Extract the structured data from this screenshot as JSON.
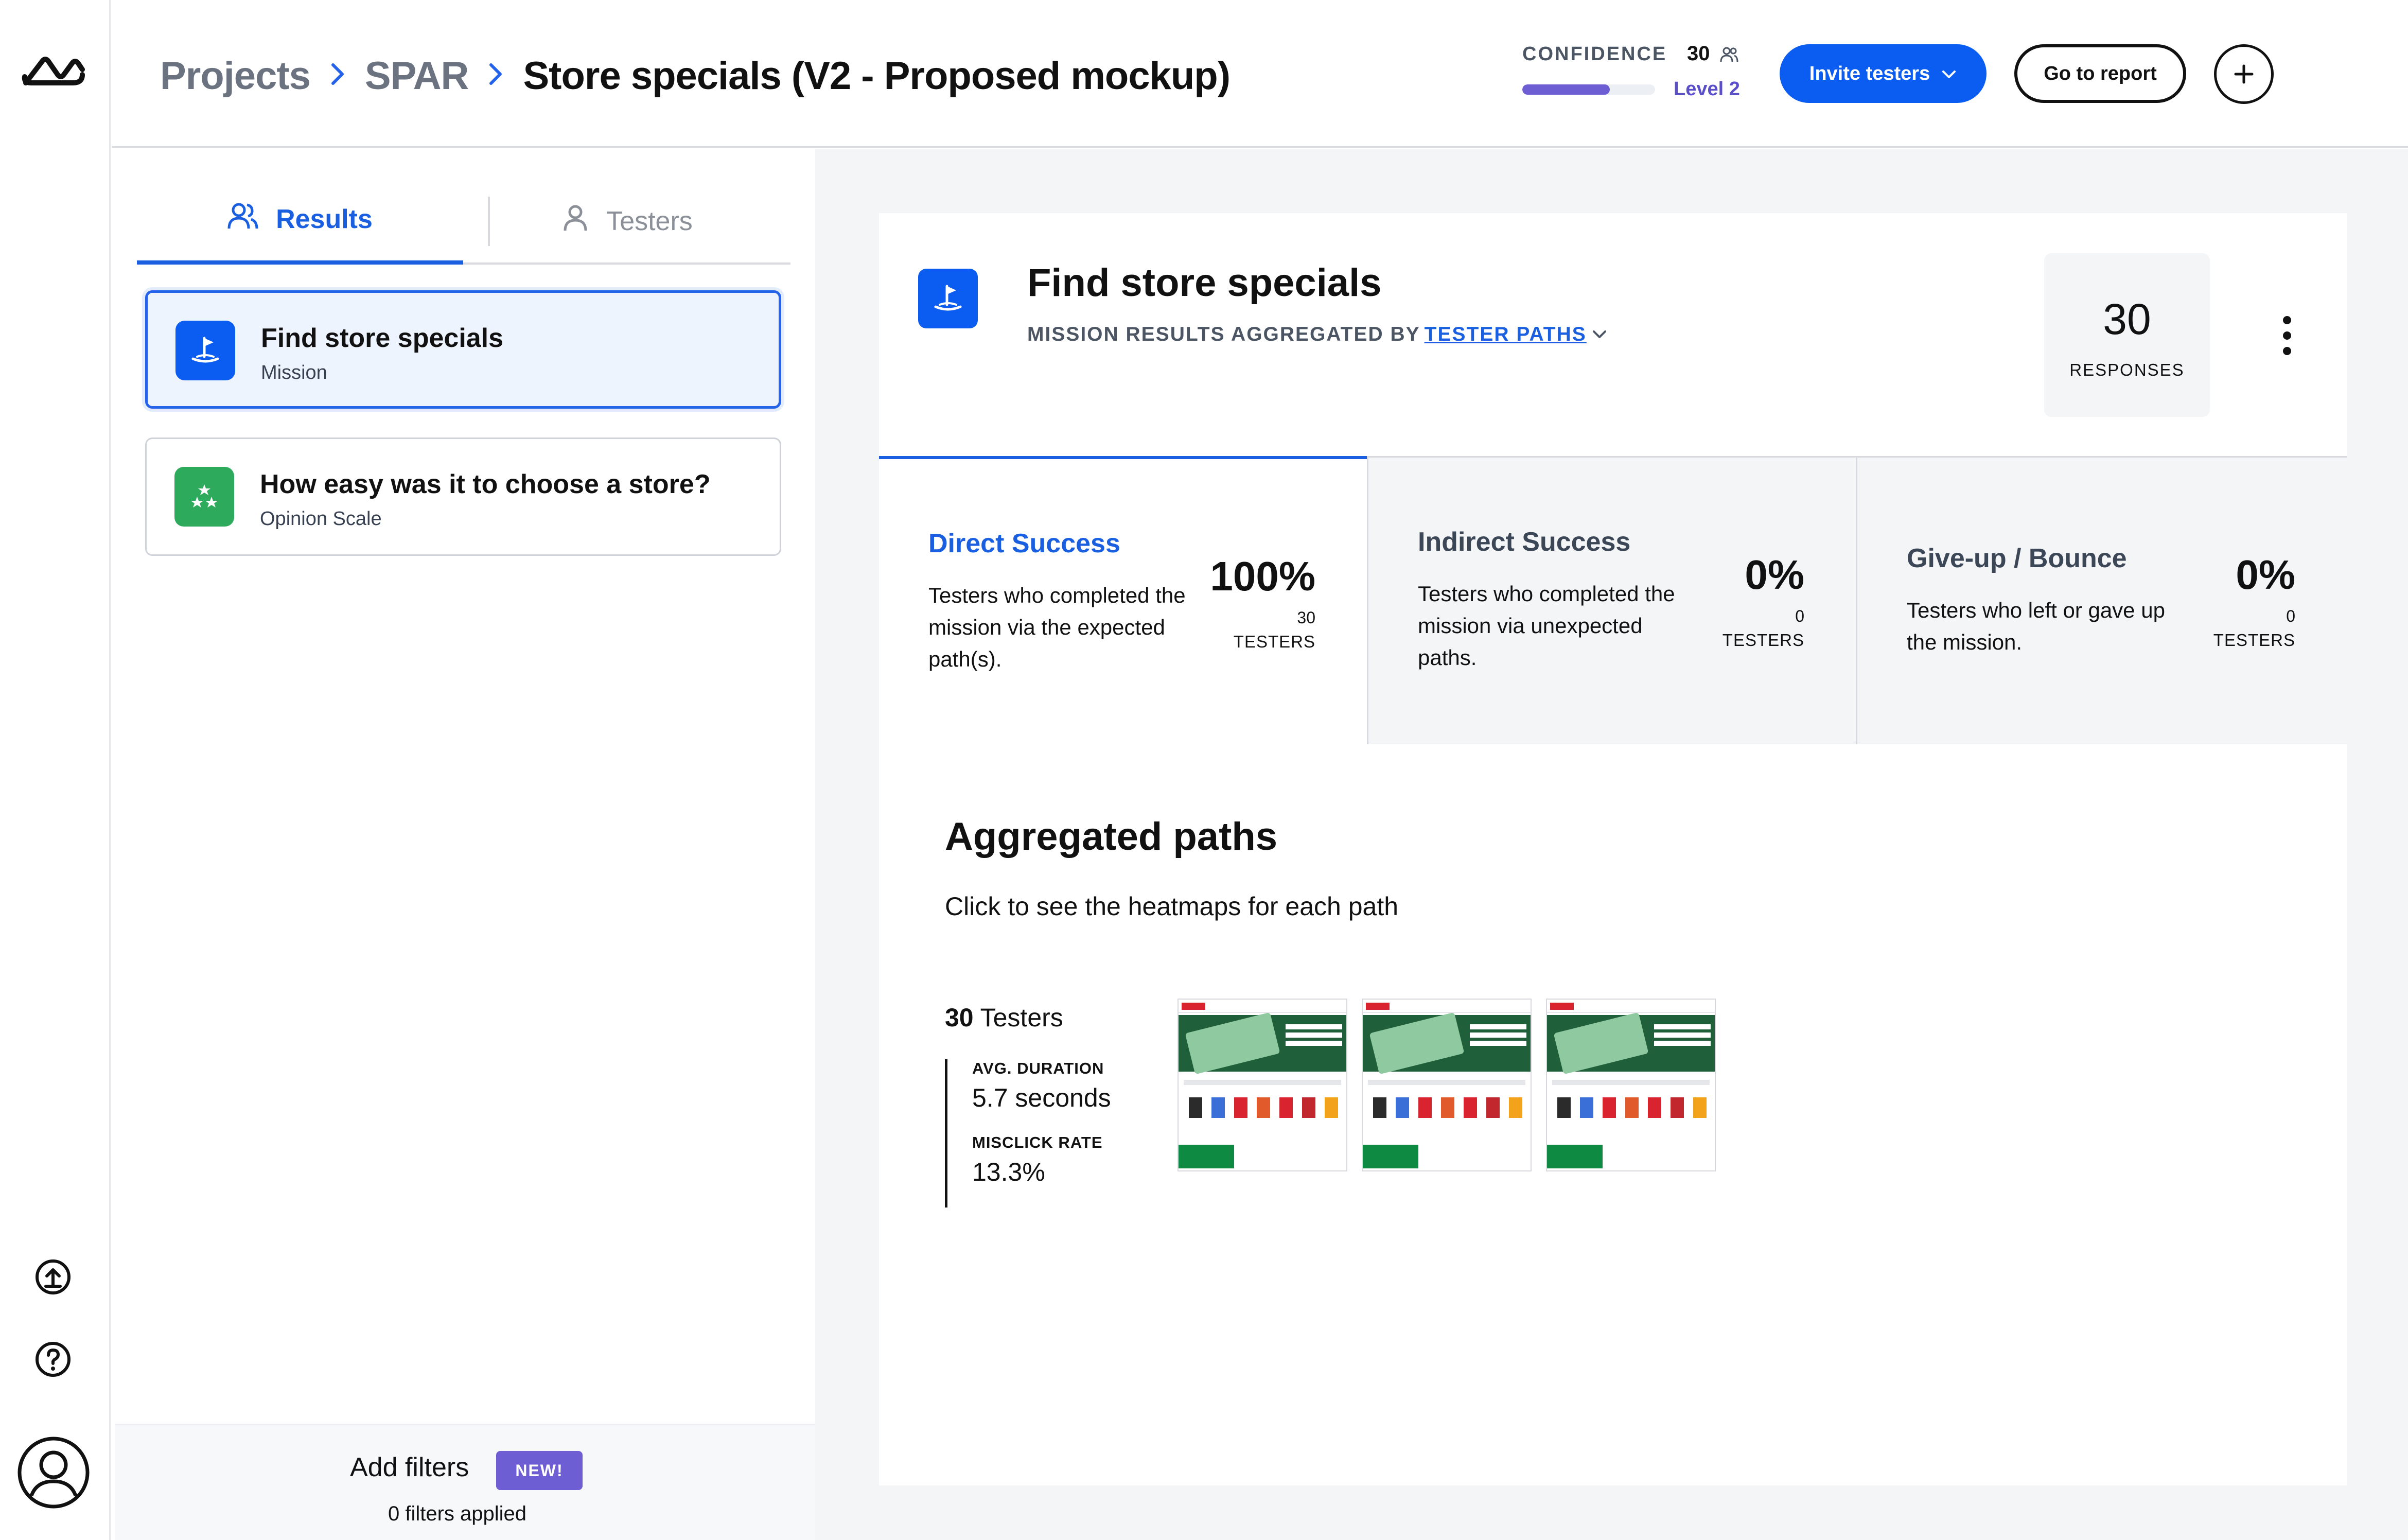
{
  "header": {
    "breadcrumbs": [
      "Projects",
      "SPAR",
      "Store specials (V2 - Proposed mockup)"
    ],
    "confidence": {
      "label": "CONFIDENCE",
      "tester_count": "30",
      "level": "Level 2",
      "progress_fraction": 0.66
    },
    "invite_button": "Invite testers",
    "report_button": "Go to report",
    "add_icon": "plus-icon",
    "settings_icon": "gear-icon"
  },
  "sidebar": {
    "tabs": [
      {
        "label": "Results",
        "icon": "people-icon",
        "active": true
      },
      {
        "label": "Testers",
        "icon": "person-icon",
        "active": false
      }
    ],
    "blocks": [
      {
        "title": "Find store specials",
        "subtitle": "Mission",
        "icon": "mission-flag-icon",
        "color": "#0b5cf0",
        "selected": true
      },
      {
        "title": "How easy was it to choose a store?",
        "subtitle": "Opinion Scale",
        "icon": "stars-icon",
        "color": "#2eaa5c",
        "selected": false
      }
    ],
    "filters": {
      "label": "Add filters",
      "badge": "NEW!",
      "applied": "0 filters applied"
    }
  },
  "rail": {
    "icons": [
      "maze-logo-icon",
      "upload-icon",
      "help-icon",
      "avatar-icon"
    ]
  },
  "main": {
    "title": "Find store specials",
    "subtitle_prefix": "MISSION RESULTS AGGREGATED BY",
    "subtitle_link": "TESTER PATHS",
    "responses": {
      "value": "30",
      "label": "RESPONSES"
    },
    "stats": [
      {
        "title": "Direct Success",
        "description": "Testers who completed the mission via the expected path(s).",
        "percent": "100%",
        "count": "30",
        "unit": "TESTERS",
        "title_color": "#1a5fe0"
      },
      {
        "title": "Indirect Success",
        "description": "Testers who completed the mission via unexpected paths.",
        "percent": "0%",
        "count": "0",
        "unit": "TESTERS",
        "title_color": "#3b4656"
      },
      {
        "title": "Give-up / Bounce",
        "description": "Testers who left or gave up the mission.",
        "percent": "0%",
        "count": "0",
        "unit": "TESTERS",
        "title_color": "#3b4656"
      }
    ],
    "aggregated": {
      "title": "Aggregated paths",
      "subtitle": "Click to see the heatmaps for each path",
      "path": {
        "count": "30",
        "count_label": "Testers",
        "duration_label": "AVG. DURATION",
        "duration_value": "5.7 seconds",
        "misclick_label": "MISCLICK RATE",
        "misclick_value": "13.3%",
        "screens": 3
      }
    }
  }
}
